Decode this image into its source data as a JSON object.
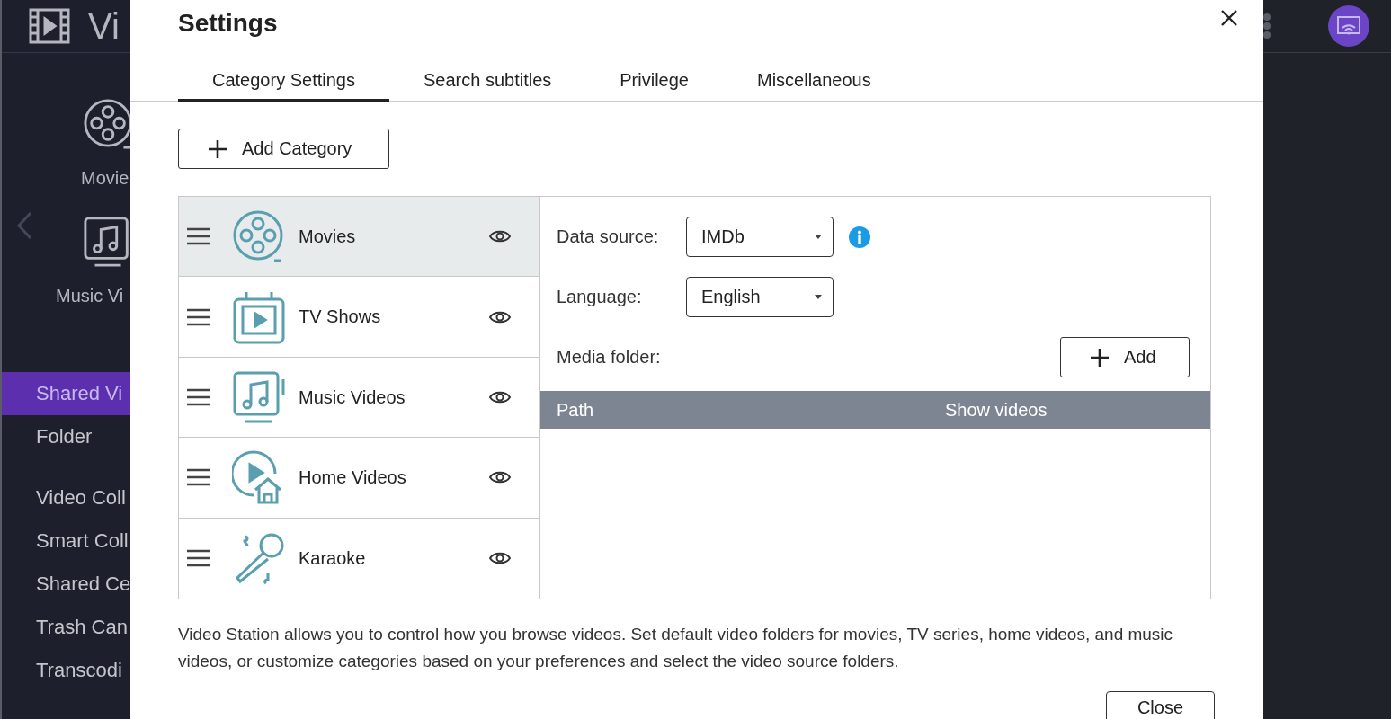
{
  "app": {
    "title": "Vi",
    "shortcuts": [
      {
        "label": "Movie",
        "kind": "movies"
      },
      {
        "label": "Music Vi",
        "kind": "music"
      }
    ],
    "nav_groups": [
      {
        "items": [
          {
            "label": "Shared Vi",
            "selected": true
          },
          {
            "label": "Folder",
            "selected": false
          }
        ]
      },
      {
        "items": [
          {
            "label": "Video Coll",
            "selected": false
          },
          {
            "label": "Smart Coll",
            "selected": false
          },
          {
            "label": "Shared Ce",
            "selected": false
          },
          {
            "label": "Trash Can",
            "selected": false
          },
          {
            "label": "Transcodi",
            "selected": false
          }
        ]
      }
    ]
  },
  "dialog": {
    "title": "Settings",
    "tabs": [
      {
        "label": "Category Settings",
        "selected": true
      },
      {
        "label": "Search subtitles",
        "selected": false
      },
      {
        "label": "Privilege",
        "selected": false
      },
      {
        "label": "Miscellaneous",
        "selected": false
      }
    ],
    "add_category_button": "Add Category",
    "categories": [
      {
        "name": "Movies",
        "kind": "movies",
        "selected": true
      },
      {
        "name": "TV Shows",
        "kind": "tv",
        "selected": false
      },
      {
        "name": "Music Videos",
        "kind": "music",
        "selected": false
      },
      {
        "name": "Home Videos",
        "kind": "home",
        "selected": false
      },
      {
        "name": "Karaoke",
        "kind": "karaoke",
        "selected": false
      }
    ],
    "form": {
      "data_source_label": "Data source:",
      "data_source": "IMDb",
      "language_label": "Language:",
      "language": "English",
      "media_folder_label": "Media folder:",
      "add_button": "Add"
    },
    "table": {
      "columns": [
        "Path",
        "Show videos"
      ]
    },
    "description": "Video Station allows you to control how you browse videos. Set default video folders for movies, TV series, home videos, and music videos, or customize categories based on your preferences and select the video source folders.",
    "close_button": "Close"
  }
}
